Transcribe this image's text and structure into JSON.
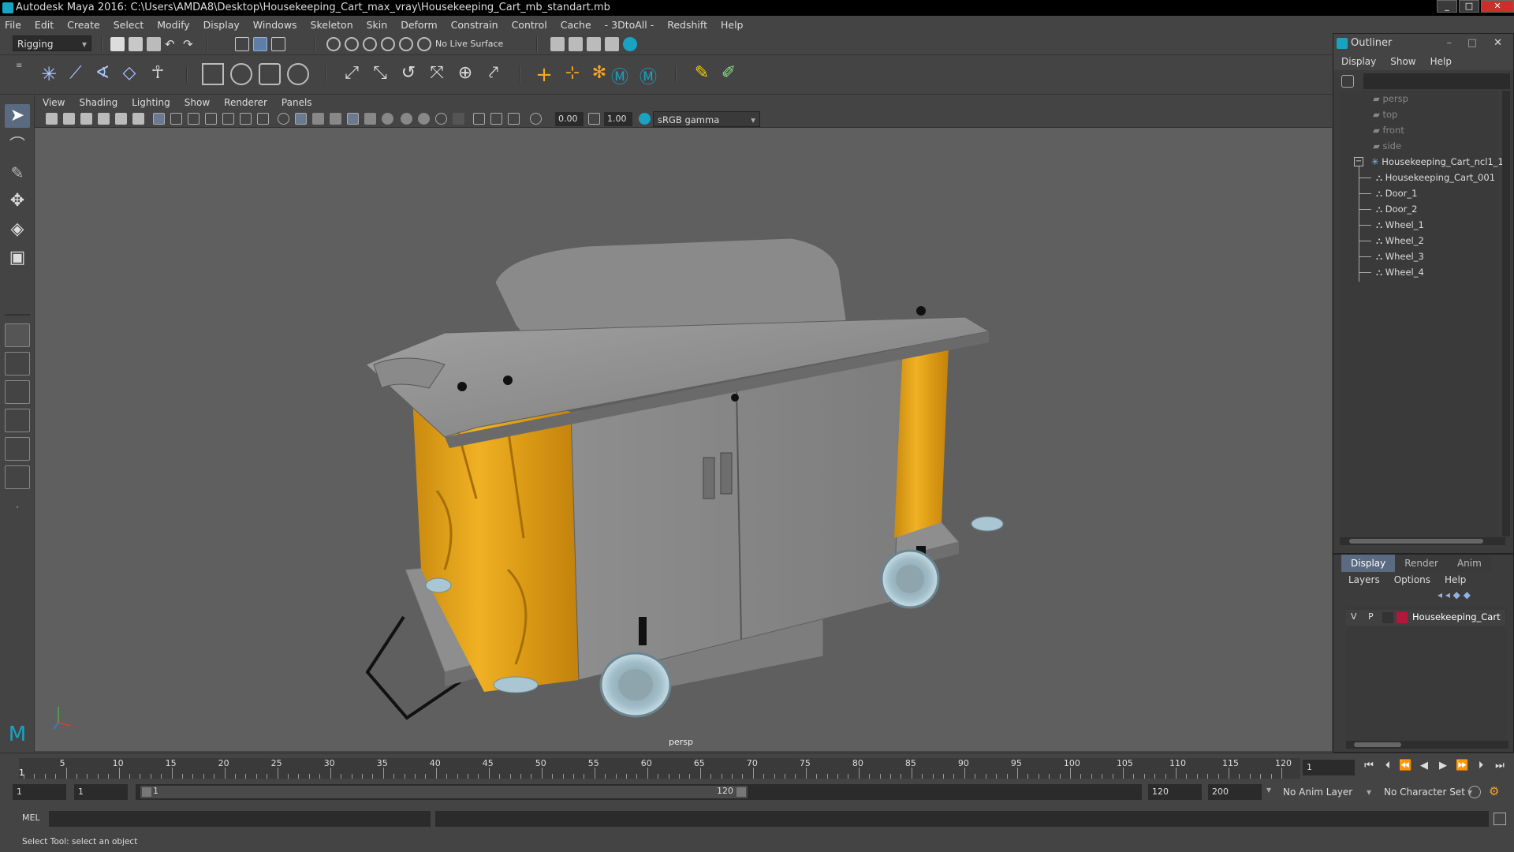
{
  "window": {
    "title": "Autodesk Maya 2016: C:\\Users\\AMDA8\\Desktop\\Housekeeping_Cart_max_vray\\Housekeeping_Cart_mb_standart.mb",
    "minimize": "_",
    "maximize": "□",
    "close": "✕"
  },
  "menus": [
    "File",
    "Edit",
    "Create",
    "Select",
    "Modify",
    "Display",
    "Windows",
    "Skeleton",
    "Skin",
    "Deform",
    "Constrain",
    "Control",
    "Cache",
    "- 3DtoAll -",
    "Redshift",
    "Help"
  ],
  "statusline": {
    "mode": "Rigging",
    "live_surface": "No Live Surface"
  },
  "viewport": {
    "menus": [
      "View",
      "Shading",
      "Lighting",
      "Show",
      "Renderer",
      "Panels"
    ],
    "exposure": "0.00",
    "gamma": "1.00",
    "color_space": "sRGB gamma",
    "camera_label": "persp"
  },
  "outliner": {
    "title": "Outliner",
    "menus": [
      "Display",
      "Show",
      "Help"
    ],
    "cameras": [
      "persp",
      "top",
      "front",
      "side"
    ],
    "group": "Housekeeping_Cart_ncl1_1",
    "children": [
      "Housekeeping_Cart_001",
      "Door_1",
      "Door_2",
      "Wheel_1",
      "Wheel_2",
      "Wheel_3",
      "Wheel_4"
    ],
    "collapse_symbol": "−"
  },
  "layers": {
    "tabs": [
      "Display",
      "Render",
      "Anim"
    ],
    "menus": [
      "Layers",
      "Options",
      "Help"
    ],
    "layer": {
      "visible": "V",
      "playback": "P",
      "name": "Housekeeping_Cart",
      "color": "#b5173a"
    }
  },
  "timeline": {
    "ticks": [
      5,
      10,
      15,
      20,
      25,
      30,
      35,
      40,
      45,
      50,
      55,
      60,
      65,
      70,
      75,
      80,
      85,
      90,
      95,
      100,
      105,
      110,
      115,
      120
    ],
    "current_frame": "1",
    "current_frame_field": "1"
  },
  "range": {
    "start": "1",
    "anim_start": "1",
    "slider_start": "1",
    "slider_end": "120",
    "end": "120",
    "anim_end": "200",
    "anim_layer": "No Anim Layer",
    "character_set": "No Character Set"
  },
  "command": {
    "lang": "MEL"
  },
  "help": {
    "text": "Select Tool: select an object"
  },
  "colors": {
    "accent": "#19a3c2",
    "bag": "#e3a21a",
    "metal": "#8c8c8c",
    "wheel": "#a9c6d2"
  }
}
